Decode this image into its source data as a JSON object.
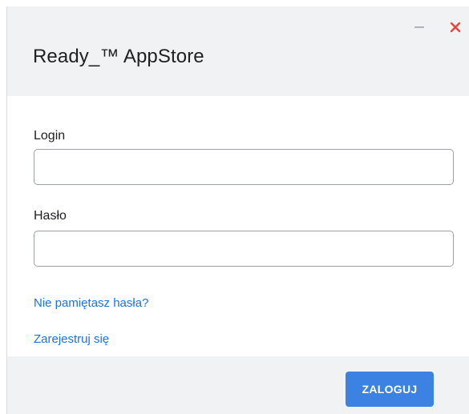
{
  "window": {
    "title": "Ready_™ AppStore",
    "minimize_icon": "minimize-icon",
    "close_icon": "close-icon",
    "close_color": "#e8453c"
  },
  "form": {
    "login_label": "Login",
    "login_value": "",
    "password_label": "Hasło",
    "password_value": "",
    "forgot_password_link": "Nie pamiętasz hasła?",
    "register_link": "Zarejestruj się"
  },
  "footer": {
    "login_button_label": "ZALOGUJ",
    "accent_color": "#3b82e2"
  }
}
